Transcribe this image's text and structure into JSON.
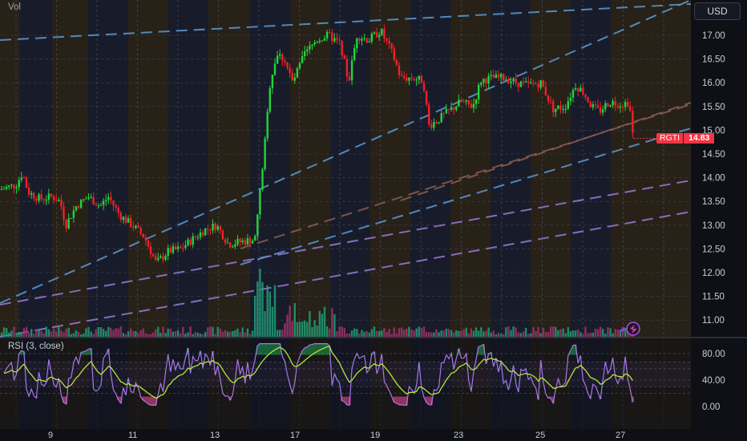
{
  "chart_data": {
    "type": "candlestick",
    "symbol": "RGTI",
    "currency": "USD",
    "last_price": "14.83",
    "price_ticks": [
      "17.00",
      "16.50",
      "16.00",
      "15.50",
      "15.00",
      "14.50",
      "14.00",
      "13.50",
      "13.00",
      "12.50",
      "12.00",
      "11.50",
      "11.00"
    ],
    "x_ticks": [
      "9",
      "11",
      "13",
      "17",
      "19",
      "23",
      "25",
      "27"
    ],
    "volume_label": "Vol",
    "indicator": {
      "name": "RSI (3, close)",
      "ticks": [
        "80.00",
        "40.00",
        "0.00"
      ]
    },
    "ohlc_path": [
      {
        "x": 0,
        "p": 13.75
      },
      {
        "x": 20,
        "p": 13.85
      },
      {
        "x": 28,
        "p": 14.1
      },
      {
        "x": 35,
        "p": 13.7
      },
      {
        "x": 50,
        "p": 13.55
      },
      {
        "x": 65,
        "p": 13.6
      },
      {
        "x": 75,
        "p": 13.5
      },
      {
        "x": 82,
        "p": 13.0
      },
      {
        "x": 95,
        "p": 13.4
      },
      {
        "x": 110,
        "p": 13.6
      },
      {
        "x": 125,
        "p": 13.4
      },
      {
        "x": 135,
        "p": 13.6
      },
      {
        "x": 150,
        "p": 13.2
      },
      {
        "x": 165,
        "p": 13.0
      },
      {
        "x": 180,
        "p": 12.75
      },
      {
        "x": 195,
        "p": 12.2
      },
      {
        "x": 210,
        "p": 12.45
      },
      {
        "x": 225,
        "p": 12.5
      },
      {
        "x": 240,
        "p": 12.7
      },
      {
        "x": 255,
        "p": 12.9
      },
      {
        "x": 270,
        "p": 13.0
      },
      {
        "x": 285,
        "p": 12.6
      },
      {
        "x": 300,
        "p": 12.65
      },
      {
        "x": 318,
        "p": 12.7
      },
      {
        "x": 325,
        "p": 13.8
      },
      {
        "x": 332,
        "p": 15.0
      },
      {
        "x": 337,
        "p": 16.0
      },
      {
        "x": 345,
        "p": 16.6
      },
      {
        "x": 355,
        "p": 16.5
      },
      {
        "x": 365,
        "p": 16.0
      },
      {
        "x": 380,
        "p": 16.6
      },
      {
        "x": 395,
        "p": 16.9
      },
      {
        "x": 410,
        "p": 17.0
      },
      {
        "x": 425,
        "p": 16.8
      },
      {
        "x": 435,
        "p": 16.0
      },
      {
        "x": 445,
        "p": 17.0
      },
      {
        "x": 460,
        "p": 16.9
      },
      {
        "x": 475,
        "p": 17.1
      },
      {
        "x": 490,
        "p": 16.6
      },
      {
        "x": 500,
        "p": 16.1
      },
      {
        "x": 515,
        "p": 16.1
      },
      {
        "x": 528,
        "p": 16.05
      },
      {
        "x": 535,
        "p": 15.1
      },
      {
        "x": 545,
        "p": 15.2
      },
      {
        "x": 560,
        "p": 15.4
      },
      {
        "x": 575,
        "p": 15.6
      },
      {
        "x": 590,
        "p": 15.5
      },
      {
        "x": 600,
        "p": 16.05
      },
      {
        "x": 615,
        "p": 16.1
      },
      {
        "x": 630,
        "p": 16.1
      },
      {
        "x": 645,
        "p": 16.0
      },
      {
        "x": 660,
        "p": 15.95
      },
      {
        "x": 675,
        "p": 16.0
      },
      {
        "x": 690,
        "p": 15.45
      },
      {
        "x": 705,
        "p": 15.5
      },
      {
        "x": 718,
        "p": 15.95
      },
      {
        "x": 728,
        "p": 15.8
      },
      {
        "x": 738,
        "p": 15.5
      },
      {
        "x": 748,
        "p": 15.4
      },
      {
        "x": 760,
        "p": 15.6
      },
      {
        "x": 775,
        "p": 15.55
      },
      {
        "x": 785,
        "p": 15.6
      },
      {
        "x": 790,
        "p": 14.83
      }
    ]
  }
}
